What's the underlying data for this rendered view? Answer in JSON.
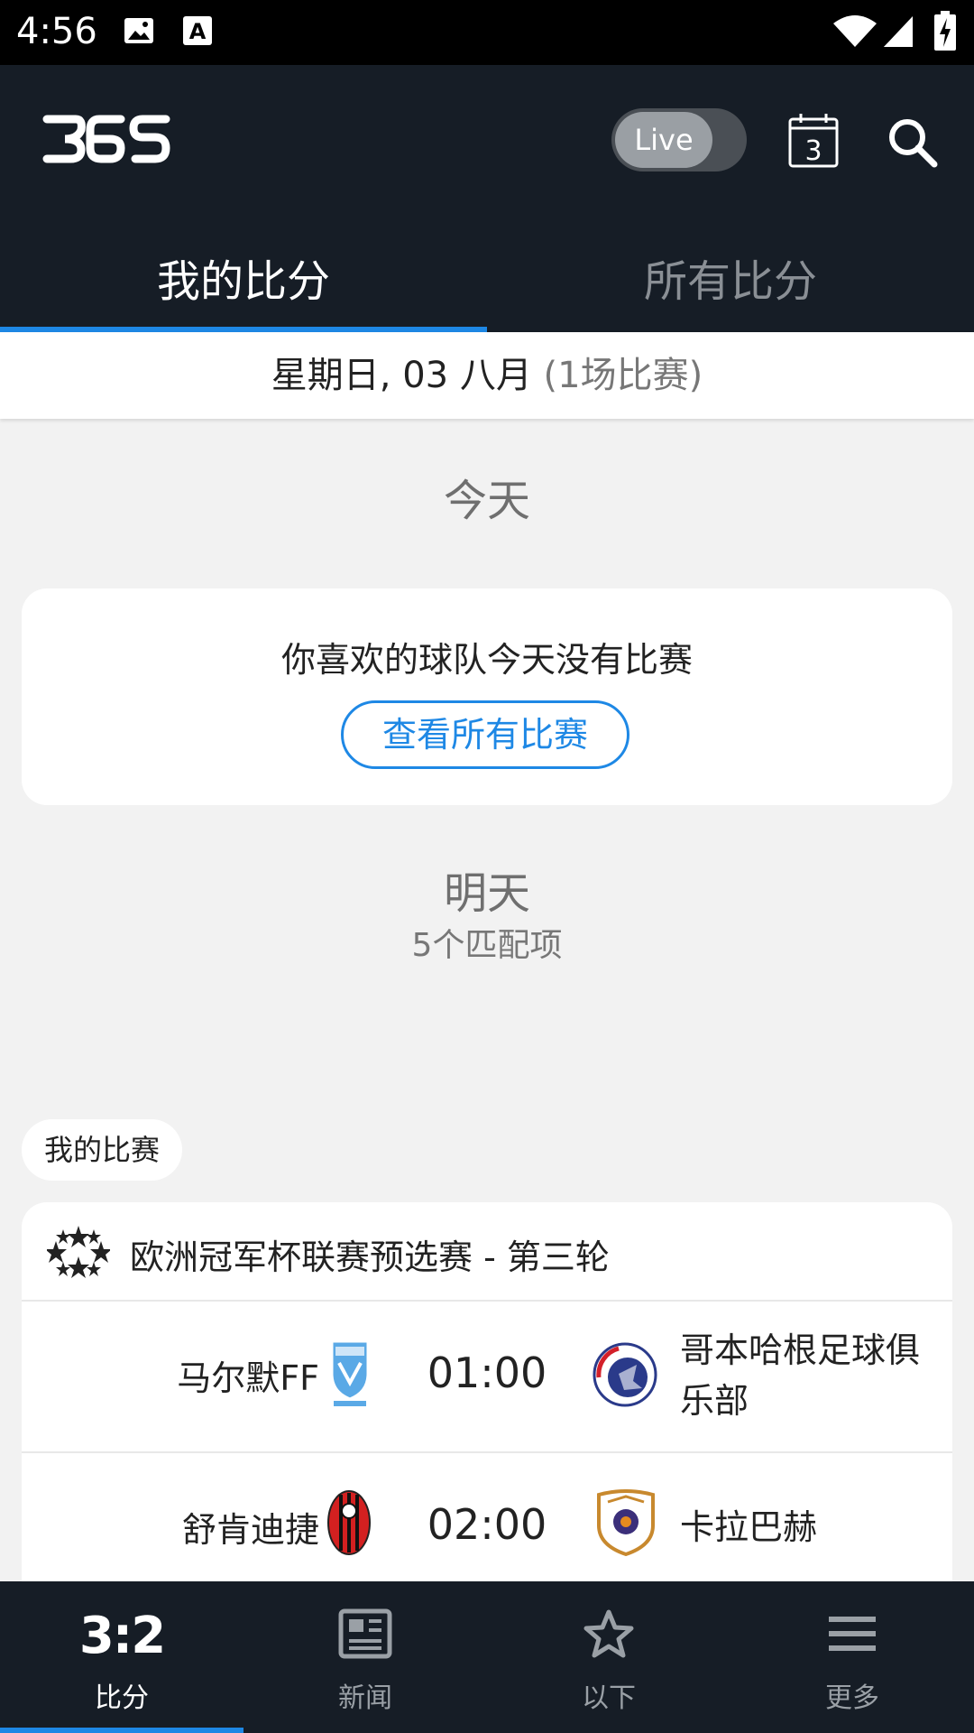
{
  "status_bar": {
    "time": "4:56",
    "icons": [
      "image-icon",
      "font-a-icon",
      "wifi-icon",
      "signal-icon",
      "battery-charging-icon"
    ]
  },
  "app_bar": {
    "logo": "365",
    "live_label": "Live",
    "calendar_day": "3",
    "icons": [
      "calendar-icon",
      "search-icon"
    ]
  },
  "tabs": [
    {
      "label": "我的比分",
      "active": true
    },
    {
      "label": "所有比分",
      "active": false
    }
  ],
  "date_bar": {
    "date": "星期日, 03 八月",
    "count": "(1场比赛)"
  },
  "today": {
    "heading": "今天",
    "empty_message": "你喜欢的球队今天没有比赛",
    "see_all_label": "查看所有比赛"
  },
  "tomorrow": {
    "heading": "明天",
    "count": "5个匹配项"
  },
  "my_matches_chip": "我的比赛",
  "league": {
    "name": "欧洲冠军杯联赛预选赛 - 第三轮",
    "icon": "champions-league-ball-icon",
    "matches": [
      {
        "home": "马尔默FF",
        "time": "01:00",
        "away": "哥本哈根足球俱乐部"
      },
      {
        "home": "舒肯迪捷",
        "time": "02:00",
        "away": "卡拉巴赫"
      }
    ]
  },
  "bottom_nav": [
    {
      "label": "比分",
      "icon": "3:2",
      "active": true
    },
    {
      "label": "新闻",
      "icon": "news-icon",
      "active": false
    },
    {
      "label": "以下",
      "icon": "star-icon",
      "active": false
    },
    {
      "label": "更多",
      "icon": "menu-icon",
      "active": false
    }
  ],
  "colors": {
    "app_bar_bg": "#161d26",
    "accent": "#1e88e5",
    "page_bg": "#f2f2f2"
  }
}
